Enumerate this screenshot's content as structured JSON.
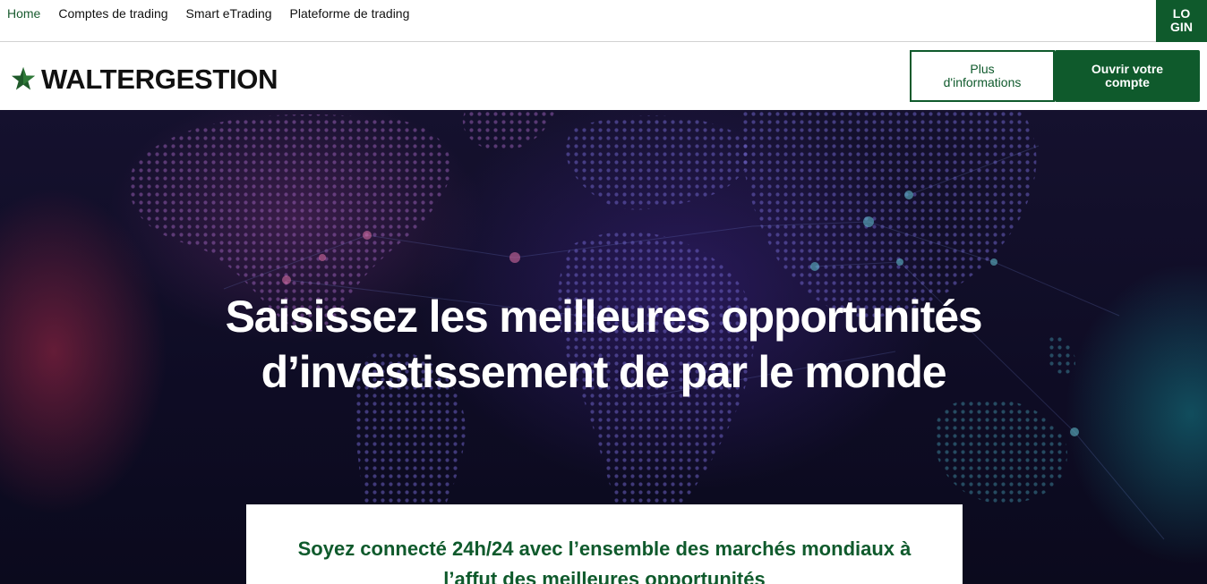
{
  "topnav": {
    "links": [
      "Home",
      "Comptes de trading",
      "Smart eTrading",
      "Plateforme de trading"
    ],
    "login_line1": "LO",
    "login_line2": "GIN"
  },
  "header": {
    "brand": "WALTERGESTION",
    "logo_icon": "star-icon",
    "info_button_line1": "Plus",
    "info_button_line2": "d'informations",
    "open_button_line1": "Ouvrir votre",
    "open_button_line2": "compte"
  },
  "hero": {
    "title_line1": "Saisissez les meilleures opportunités",
    "title_line2": "d’investissement de par le monde",
    "card_line1": "Soyez connecté 24h/24 avec l’ensemble des marchés mondiaux à",
    "card_line2": "l’affut des meilleures opportunités"
  },
  "colors": {
    "brand_green": "#0f5a2c",
    "hero_bg": "#0e0c24"
  }
}
